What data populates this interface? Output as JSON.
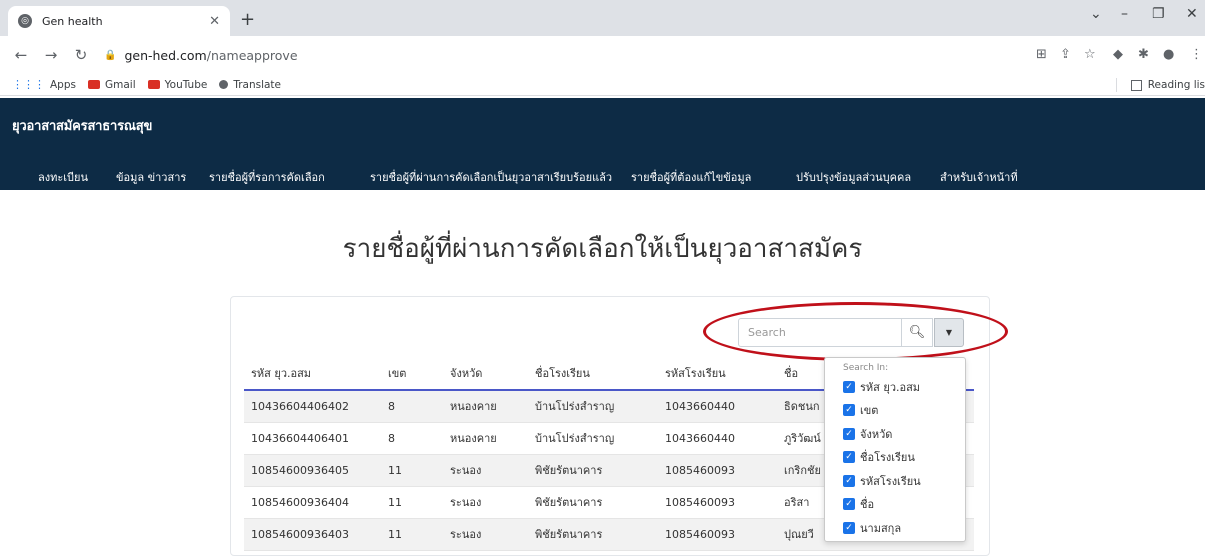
{
  "browser": {
    "tab_title": "Gen health",
    "url_host": "gen-hed.com",
    "url_path": "/nameapprove",
    "bookmarks": [
      "Apps",
      "Gmail",
      "YouTube",
      "Translate"
    ],
    "reading_list": "Reading lis"
  },
  "site": {
    "brand": "ยุวอาสาสมัครสาธารณสุข",
    "menu": [
      "ลงทะเบียน",
      "ข้อมูล ข่าวสาร",
      "รายชื่อผู้ที่รอการคัดเลือก",
      "รายชื่อผู้ที่ผ่านการคัดเลือกเป็นยุวอาสาเรียบร้อยแล้ว",
      "รายชื่อผู้ที่ต้องแก้ไขข้อมูล",
      "ปรับปรุงข้อมูลส่วนบุคคล",
      "สำหรับเจ้าหน้าที่"
    ]
  },
  "page": {
    "title": "รายชื่อผู้ที่ผ่านการคัดเลือกให้เป็นยุวอาสาสมัคร"
  },
  "search": {
    "placeholder": "Search",
    "dropdown_header": "Search In:",
    "options": [
      "รหัส ยุว.อสม",
      "เขต",
      "จังหวัด",
      "ชื่อโรงเรียน",
      "รหัสโรงเรียน",
      "ชื่อ",
      "นามสกุล"
    ]
  },
  "table": {
    "columns": [
      "รหัส ยุว.อสม",
      "เขต",
      "จังหวัด",
      "ชื่อโรงเรียน",
      "รหัสโรงเรียน",
      "ชื่อ",
      ""
    ],
    "rows": [
      [
        "10436604406402",
        "8",
        "หนองคาย",
        "บ้านโปร่งสำราญ",
        "1043660440",
        "ธิดชนก",
        ""
      ],
      [
        "10436604406401",
        "8",
        "หนองคาย",
        "บ้านโปร่งสำราญ",
        "1043660440",
        "ภูริวัฒน์",
        ""
      ],
      [
        "10854600936405",
        "11",
        "ระนอง",
        "พิชัยรัตนาคาร",
        "1085460093",
        "เกริกชัย",
        ""
      ],
      [
        "10854600936404",
        "11",
        "ระนอง",
        "พิชัยรัตนาคาร",
        "1085460093",
        "อริสา",
        ""
      ],
      [
        "10854600936403",
        "11",
        "ระนอง",
        "พิชัยรัตนาคาร",
        "1085460093",
        "ปุณยวี",
        ""
      ]
    ]
  },
  "colors": {
    "header_bg": "#0d2b45",
    "accent": "#4a57c8",
    "annotation": "#c0101a"
  }
}
